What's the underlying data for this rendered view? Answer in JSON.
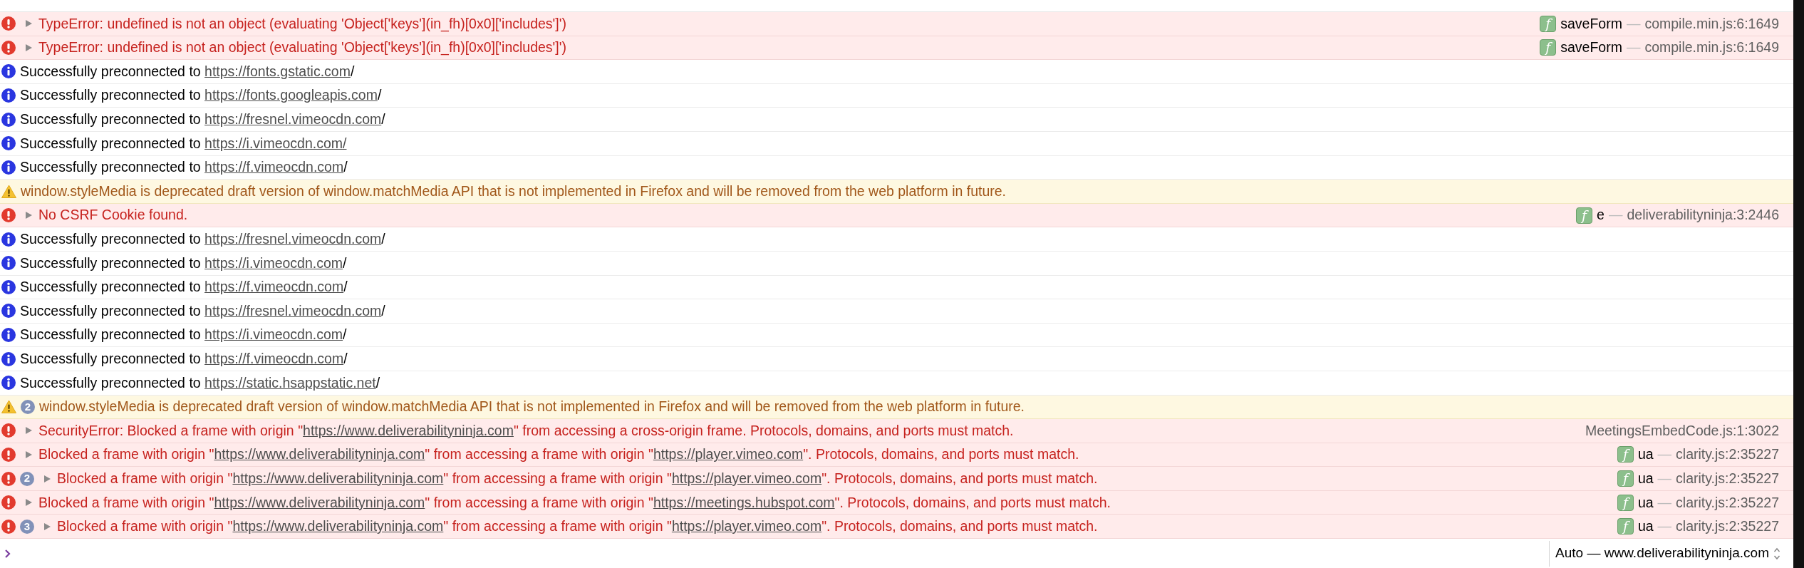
{
  "console": {
    "entries": [
      {
        "kind": "error",
        "expanded": false,
        "message": [
          {
            "text": "TypeError: undefined is not an object (evaluating 'Object['keys'](in_fh)[0x0]['includes']')"
          }
        ],
        "source": {
          "badge": "f",
          "function": "saveForm",
          "dash": "—",
          "location": "compile.min.js:6:1649"
        }
      },
      {
        "kind": "error",
        "expanded": false,
        "message": [
          {
            "text": "TypeError: undefined is not an object (evaluating 'Object['keys'](in_fh)[0x0]['includes']')"
          }
        ],
        "source": {
          "badge": "f",
          "function": "saveForm",
          "dash": "—",
          "location": "compile.min.js:6:1649"
        }
      },
      {
        "kind": "info",
        "message": [
          {
            "text": "Successfully preconnected to "
          },
          {
            "text": "https://fonts.gstatic.com",
            "link": true
          },
          {
            "text": "/"
          }
        ]
      },
      {
        "kind": "info",
        "message": [
          {
            "text": "Successfully preconnected to "
          },
          {
            "text": "https://fonts.googleapis.com",
            "link": true
          },
          {
            "text": "/"
          }
        ]
      },
      {
        "kind": "info",
        "message": [
          {
            "text": "Successfully preconnected to "
          },
          {
            "text": "https://fresnel.vimeocdn.com",
            "link": true
          },
          {
            "text": "/"
          }
        ]
      },
      {
        "kind": "info",
        "message": [
          {
            "text": "Successfully preconnected to "
          },
          {
            "text": "https://i.vimeocdn.com/",
            "link": true
          }
        ]
      },
      {
        "kind": "info",
        "message": [
          {
            "text": "Successfully preconnected to "
          },
          {
            "text": "https://f.vimeocdn.com",
            "link": true
          },
          {
            "text": "/"
          }
        ]
      },
      {
        "kind": "warning",
        "message": [
          {
            "text": "window.styleMedia is deprecated draft version of window.matchMedia API that is not implemented in Firefox and will be removed from the web platform in future."
          }
        ]
      },
      {
        "kind": "error",
        "expanded": false,
        "message": [
          {
            "text": "No CSRF Cookie found."
          }
        ],
        "source": {
          "badge": "f",
          "function": "e",
          "dash": "—",
          "location": "deliverabilityninja:3:2446"
        }
      },
      {
        "kind": "info",
        "message": [
          {
            "text": "Successfully preconnected to "
          },
          {
            "text": "https://fresnel.vimeocdn.com",
            "link": true
          },
          {
            "text": "/"
          }
        ]
      },
      {
        "kind": "info",
        "message": [
          {
            "text": "Successfully preconnected to "
          },
          {
            "text": "https://i.vimeocdn.com",
            "link": true
          },
          {
            "text": "/"
          }
        ]
      },
      {
        "kind": "info",
        "message": [
          {
            "text": "Successfully preconnected to "
          },
          {
            "text": "https://f.vimeocdn.com",
            "link": true
          },
          {
            "text": "/"
          }
        ]
      },
      {
        "kind": "info",
        "message": [
          {
            "text": "Successfully preconnected to "
          },
          {
            "text": "https://fresnel.vimeocdn.com",
            "link": true
          },
          {
            "text": "/"
          }
        ]
      },
      {
        "kind": "info",
        "message": [
          {
            "text": "Successfully preconnected to "
          },
          {
            "text": "https://i.vimeocdn.com",
            "link": true
          },
          {
            "text": "/"
          }
        ]
      },
      {
        "kind": "info",
        "message": [
          {
            "text": "Successfully preconnected to "
          },
          {
            "text": "https://f.vimeocdn.com",
            "link": true
          },
          {
            "text": "/"
          }
        ]
      },
      {
        "kind": "info",
        "message": [
          {
            "text": "Successfully preconnected to "
          },
          {
            "text": "https://static.hsappstatic.net",
            "link": true
          },
          {
            "text": "/"
          }
        ]
      },
      {
        "kind": "warning",
        "count": "2",
        "message": [
          {
            "text": "window.styleMedia is deprecated draft version of window.matchMedia API that is not implemented in Firefox and will be removed from the web platform in future."
          }
        ]
      },
      {
        "kind": "error",
        "expanded": false,
        "message": [
          {
            "text": "SecurityError: Blocked a frame with origin \""
          },
          {
            "text": "https://www.deliverabilityninja.com",
            "link": true
          },
          {
            "text": "\" from accessing a cross-origin frame. Protocols, domains, and ports must match."
          }
        ],
        "source": {
          "location": "MeetingsEmbedCode.js:1:3022"
        }
      },
      {
        "kind": "error",
        "expanded": false,
        "message": [
          {
            "text": "Blocked a frame with origin \""
          },
          {
            "text": "https://www.deliverabilityninja.com",
            "link": true
          },
          {
            "text": "\" from accessing a frame with origin \""
          },
          {
            "text": "https://player.vimeo.com",
            "link": true
          },
          {
            "text": "\". Protocols, domains, and ports must match."
          }
        ],
        "source": {
          "badge": "f",
          "function": "ua",
          "dash": "—",
          "location": "clarity.js:2:35227"
        }
      },
      {
        "kind": "error",
        "count": "2",
        "expanded": false,
        "message": [
          {
            "text": "Blocked a frame with origin \""
          },
          {
            "text": "https://www.deliverabilityninja.com",
            "link": true
          },
          {
            "text": "\" from accessing a frame with origin \""
          },
          {
            "text": "https://player.vimeo.com",
            "link": true
          },
          {
            "text": "\". Protocols, domains, and ports must match."
          }
        ],
        "source": {
          "badge": "f",
          "function": "ua",
          "dash": "—",
          "location": "clarity.js:2:35227"
        }
      },
      {
        "kind": "error",
        "expanded": false,
        "message": [
          {
            "text": "Blocked a frame with origin \""
          },
          {
            "text": "https://www.deliverabilityninja.com",
            "link": true
          },
          {
            "text": "\" from accessing a frame with origin \""
          },
          {
            "text": "https://meetings.hubspot.com",
            "link": true
          },
          {
            "text": "\". Protocols, domains, and ports must match."
          }
        ],
        "source": {
          "badge": "f",
          "function": "ua",
          "dash": "—",
          "location": "clarity.js:2:35227"
        }
      },
      {
        "kind": "error",
        "count": "3",
        "expanded": false,
        "message": [
          {
            "text": "Blocked a frame with origin \""
          },
          {
            "text": "https://www.deliverabilityninja.com",
            "link": true
          },
          {
            "text": "\" from accessing a frame with origin \""
          },
          {
            "text": "https://player.vimeo.com",
            "link": true
          },
          {
            "text": "\". Protocols, domains, and ports must match."
          }
        ],
        "source": {
          "badge": "f",
          "function": "ua",
          "dash": "—",
          "location": "clarity.js:2:35227"
        }
      }
    ]
  },
  "prompt": {
    "context": "Auto — www.deliverabilityninja.com"
  }
}
